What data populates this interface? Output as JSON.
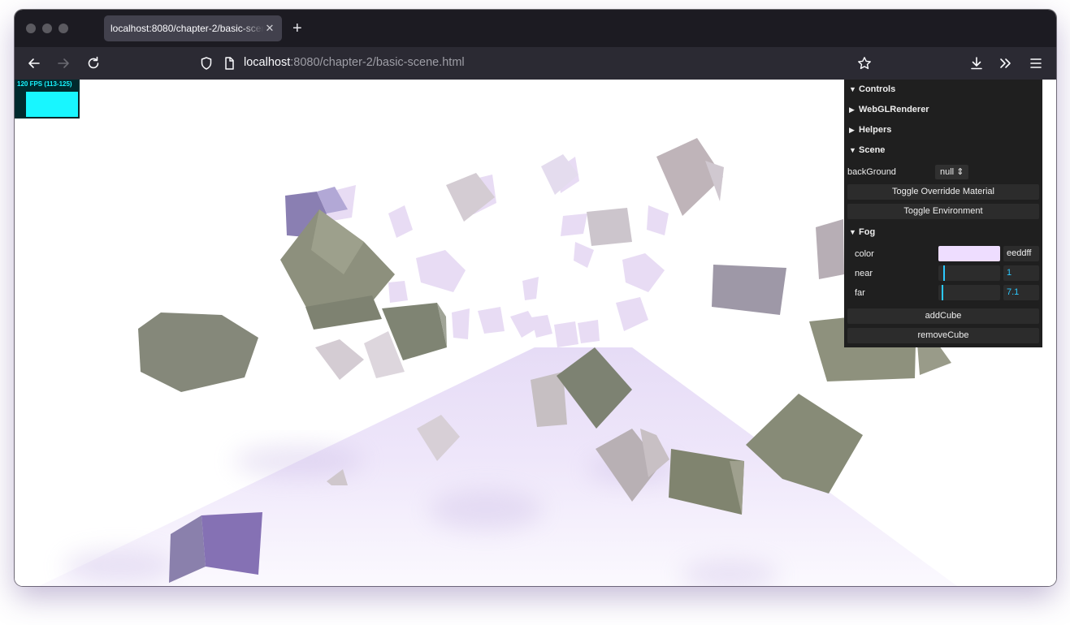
{
  "browser": {
    "tab_title": "localhost:8080/chapter-2/basic-scene.html",
    "url_host": "localhost",
    "url_rest": ":8080/chapter-2/basic-scene.html",
    "icons": [
      "back-icon",
      "forward-icon",
      "reload-icon",
      "shield-icon",
      "page-icon",
      "star-icon",
      "download-icon",
      "overflow-icon",
      "menu-icon"
    ]
  },
  "stats": {
    "text": "120 FPS (113-125)",
    "color": "#18f6ff"
  },
  "gui": {
    "folders": {
      "controls": "Controls",
      "webgl": "WebGLRenderer",
      "helpers": "Helpers",
      "scene": "Scene",
      "fog": "Fog"
    },
    "scene": {
      "background_label": "backGround",
      "background_value": "null",
      "toggle_override": "Toggle Overridde Material",
      "toggle_environment": "Toggle Environment"
    },
    "fog": {
      "color_label": "color",
      "color_value": "eeddff",
      "color_hex": "#eeddff",
      "near_label": "near",
      "near_value": "1",
      "near_fraction": 0.04,
      "far_label": "far",
      "far_value": "7.1",
      "far_fraction": 0.02
    },
    "add_cube": "addCube",
    "remove_cube": "removeCube"
  }
}
